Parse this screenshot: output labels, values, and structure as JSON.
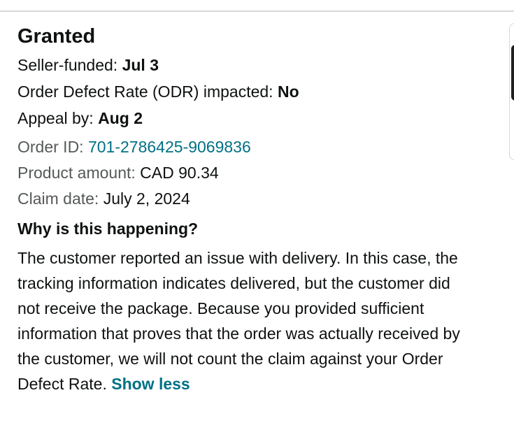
{
  "claim": {
    "status": "Granted",
    "seller_funded": {
      "label": "Seller-funded: ",
      "value": "Jul 3"
    },
    "odr_impacted": {
      "label": "Order Defect Rate (ODR) impacted: ",
      "value": "No"
    },
    "appeal_by": {
      "label": "Appeal by: ",
      "value": "Aug 2"
    },
    "order_id": {
      "label": "Order ID: ",
      "value": "701-2786425-9069836"
    },
    "product_amount": {
      "label": "Product amount: ",
      "value": "CAD 90.34"
    },
    "claim_date": {
      "label": "Claim date: ",
      "value": "July 2, 2024"
    },
    "why_heading": "Why is this happening?",
    "explanation": "The customer reported an issue with delivery. In this case, the tracking information indicates delivered, but the customer did not receive the package. Because you provided sufficient information that proves that the order was actually received by the customer, we will not count the claim against your Order Defect Rate. ",
    "show_less_label": "Show less"
  },
  "colors": {
    "link": "#007185",
    "text": "#0f1111",
    "muted_label": "#565959",
    "divider": "#d5d9d9"
  }
}
